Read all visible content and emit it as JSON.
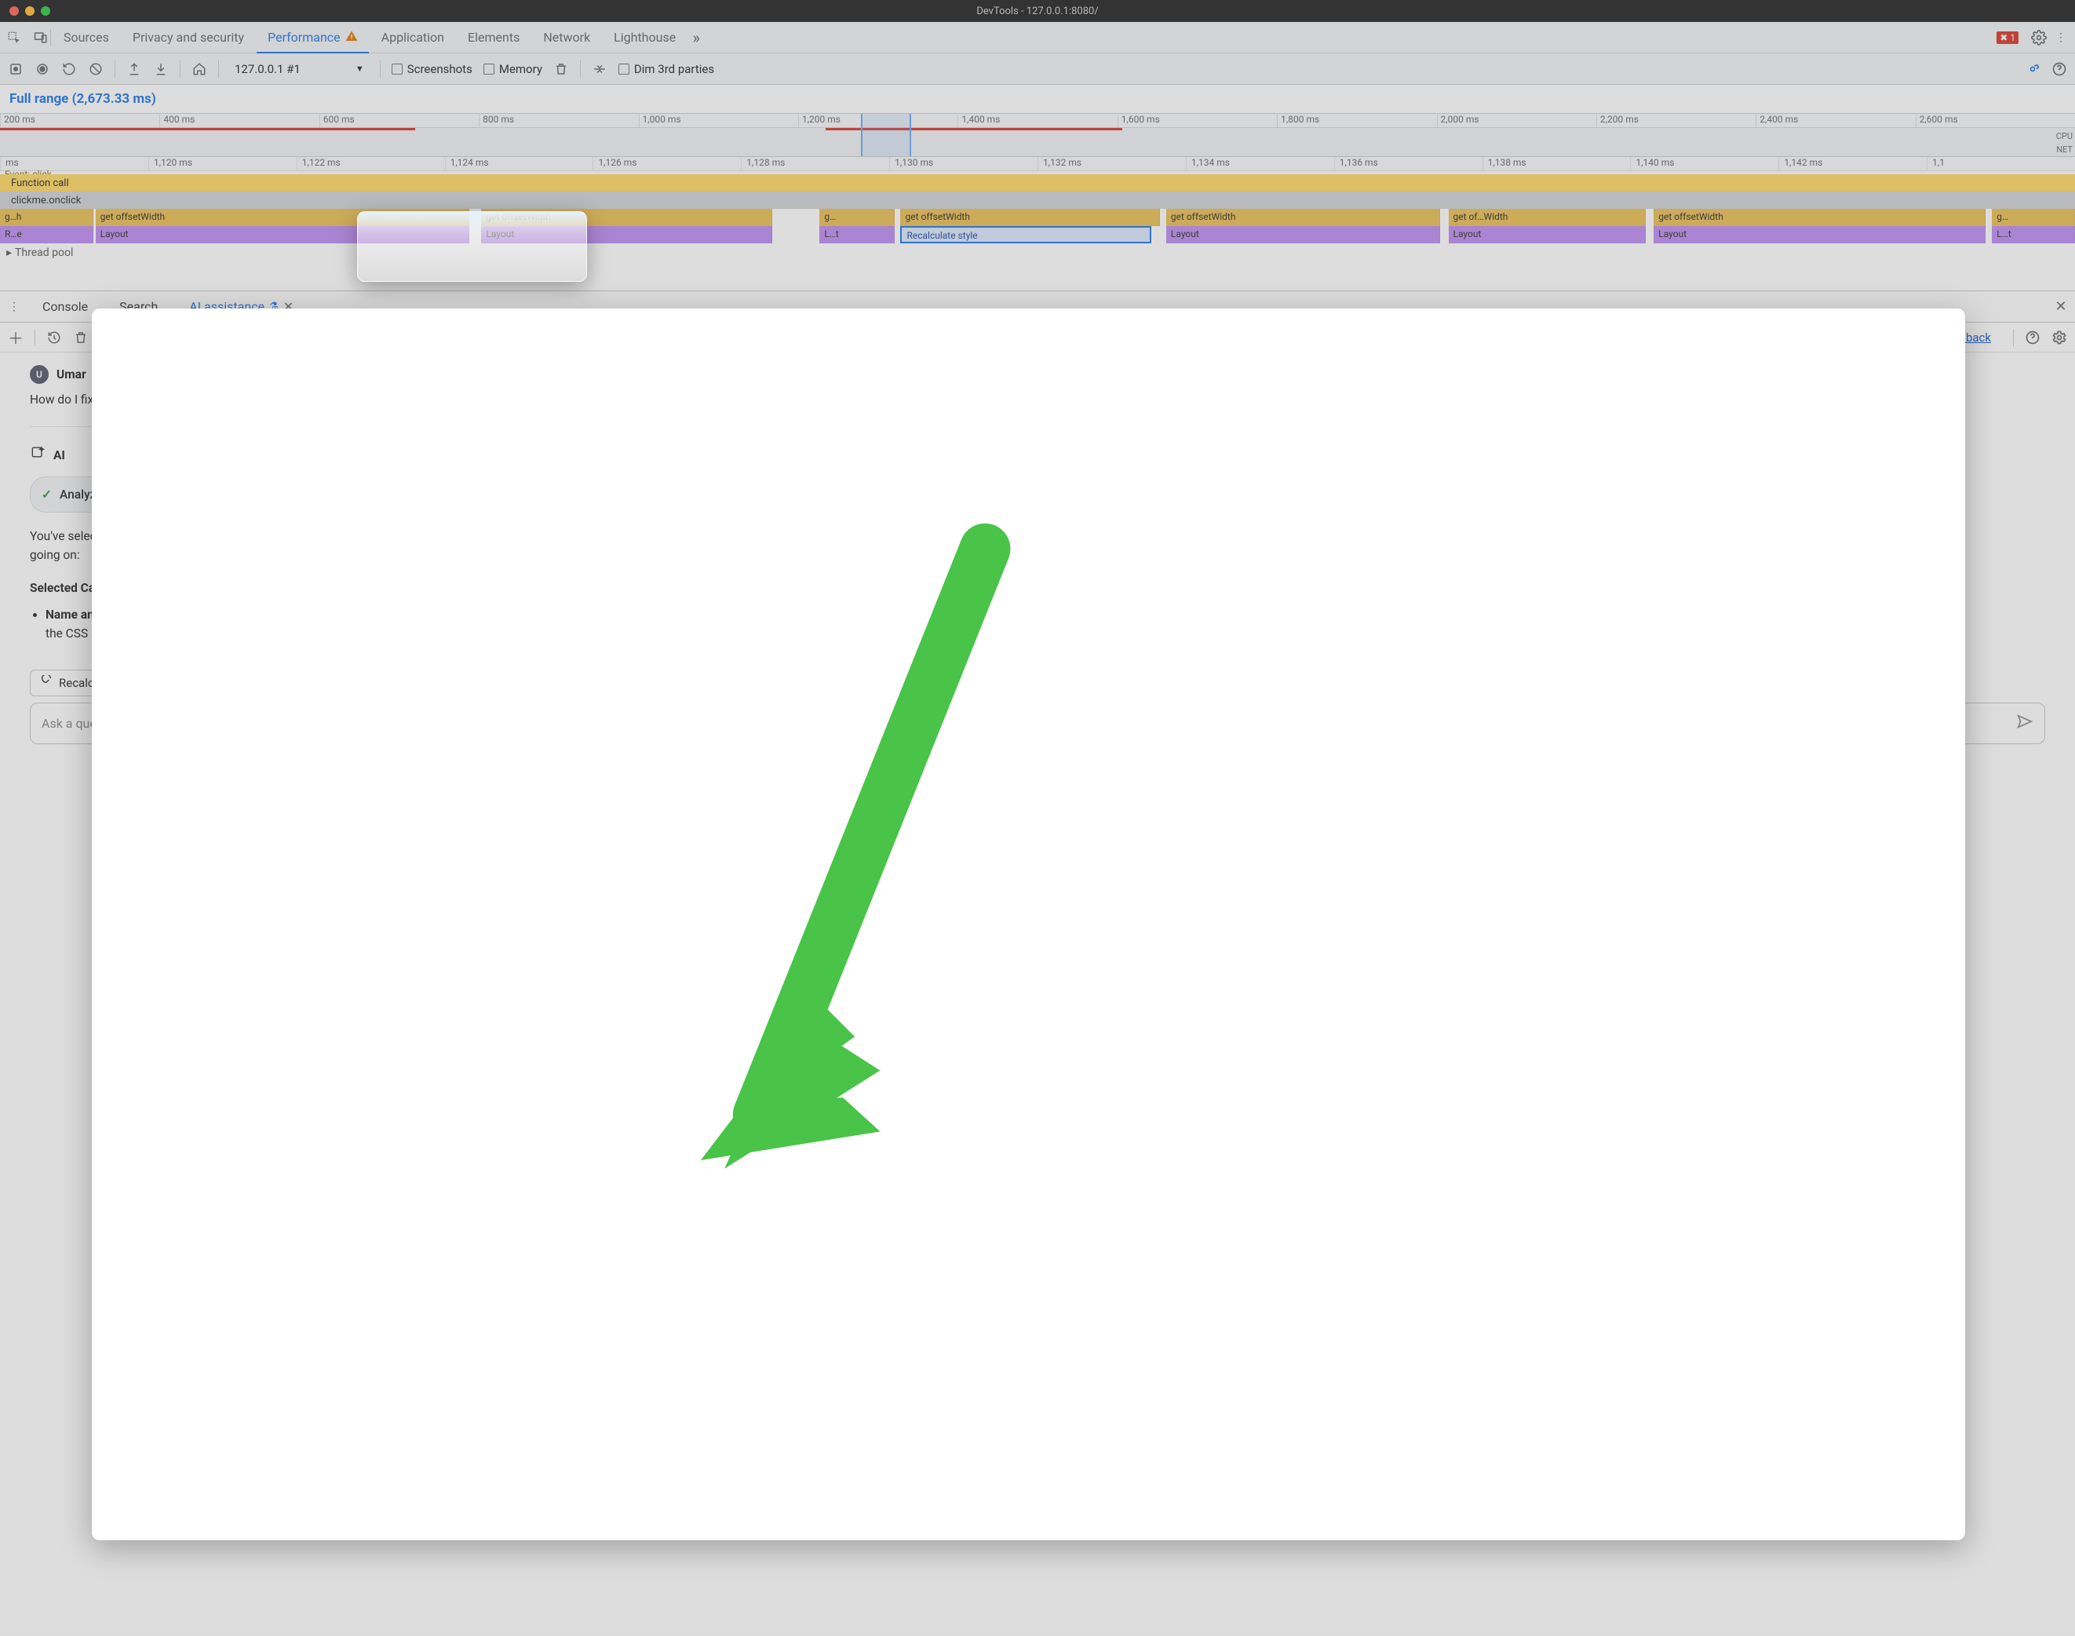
{
  "window_title": "DevTools - 127.0.0.1:8080/",
  "tabs": {
    "sources": "Sources",
    "privacy": "Privacy and security",
    "performance": "Performance",
    "application": "Application",
    "elements": "Elements",
    "network": "Network",
    "lighthouse": "Lighthouse"
  },
  "error_count": "1",
  "toolbar": {
    "target": "127.0.0.1 #1",
    "screenshots": "Screenshots",
    "memory": "Memory",
    "dim": "Dim 3rd parties"
  },
  "range_label": "Full range (2,673.33 ms)",
  "overview_ticks": [
    "200 ms",
    "400 ms",
    "600 ms",
    "800 ms",
    "1,000 ms",
    "1,200 ms",
    "1,400 ms",
    "1,600 ms",
    "1,800 ms",
    "2,000 ms",
    "2,200 ms",
    "2,400 ms",
    "2,600 ms"
  ],
  "overview_labels": {
    "cpu": "CPU",
    "net": "NET"
  },
  "detail_ticks": [
    "ms",
    "1,120 ms",
    "1,122 ms",
    "1,124 ms",
    "1,126 ms",
    "1,128 ms",
    "1,130 ms",
    "1,132 ms",
    "1,134 ms",
    "1,136 ms",
    "1,138 ms",
    "1,140 ms",
    "1,142 ms",
    "1,1"
  ],
  "detail_rows": {
    "event": "Event: click",
    "fn": "Function call",
    "onclick": "clickme.onclick",
    "gh": "g…h",
    "getoffset": "get offsetWidth",
    "gdots": "g…",
    "goffw": "get of…Width",
    "re": "R…e",
    "layout": "Layout",
    "lt": "L…t",
    "recalc": "Recalculate style",
    "thread": "Thread pool"
  },
  "drawer": {
    "console": "Console",
    "search": "Search",
    "ai": "AI assistance",
    "send_feedback": "Send feedback"
  },
  "chat": {
    "user_name": "Umar",
    "user_initial": "U",
    "user_msg": "How do I fix this?",
    "ai_label": "AI",
    "chip": "Analyzing call tree",
    "p1": "You've selected \"Recalculate style\", which is a browser operation triggered during the handling of a click event. Let's examine what's going on:",
    "h1": "Selected Callframe Analysis:",
    "li_strong": "Name and Purpose:",
    "li_rest": " The selected callframe is \"Recalculate style\". This operation occurs when the browser needs to recompute the CSS styles of elements on the page. This can happen when elements are added,"
  },
  "footer": {
    "pill": "Recalculate style",
    "placeholder": "Ask a question about the selected item and its call tree"
  }
}
